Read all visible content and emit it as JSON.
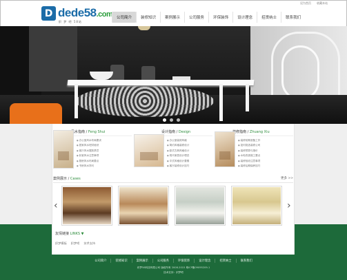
{
  "toplinks": [
    "设为首页",
    "收藏本站"
  ],
  "logo": {
    "brand": "dede",
    "num": "58",
    "dom": ".com",
    "sub": "织 梦 吧 58站"
  },
  "nav": [
    "公司简介",
    "装修知识",
    "案例展示",
    "公司服务",
    "环保装饰",
    "设计理念",
    "招贤纳士",
    "联系我们"
  ],
  "nav_active_index": 0,
  "services": [
    {
      "title": "风水指南",
      "en": "Feng Shui",
      "items": [
        "办公室风水布局要诀",
        "居家风水旺财秘诀",
        "客厅风水摆放禁忌",
        "卧室风水注意事项",
        "厨房风水布局要点",
        "书房风水学问"
      ]
    },
    {
      "title": "设计指南",
      "en": "Design",
      "items": [
        "办公室装修风格",
        "简约风格装修设计",
        "欧式古典风格设计",
        "现代家居设计理念",
        "中式风格设计要素",
        "客厅装修设计技巧"
      ]
    },
    {
      "title": "装修指南",
      "en": "Zhuang Xiu",
      "items": [
        "装修前期准备工作",
        "如何挑选装修公司",
        "装修预算与报价",
        "水电改造施工要点",
        "装修验收注意事项",
        "装修后期保养技巧"
      ]
    }
  ],
  "cases": {
    "title": "案例展示",
    "en": "Cases",
    "more": "更多 >>"
  },
  "links": {
    "title": "友情链接",
    "en": "LINKS ▼",
    "items": [
      "织梦模板",
      "织梦吧",
      "技术支持"
    ]
  },
  "footer": {
    "nav": [
      "公司简介",
      "装修知识",
      "案例展示",
      "公司服务",
      "环保装饰",
      "设计理念",
      "招贤纳士",
      "联系我们"
    ],
    "copyright": "织梦58科技有限公司 版权所有 2008-2015 粤ICP备09095209-1",
    "support": "技术支持：织梦吧"
  },
  "colors": {
    "brand_blue": "#1b6ca8",
    "brand_green": "#2d8c3c",
    "footer_green": "#1d6a3a"
  }
}
